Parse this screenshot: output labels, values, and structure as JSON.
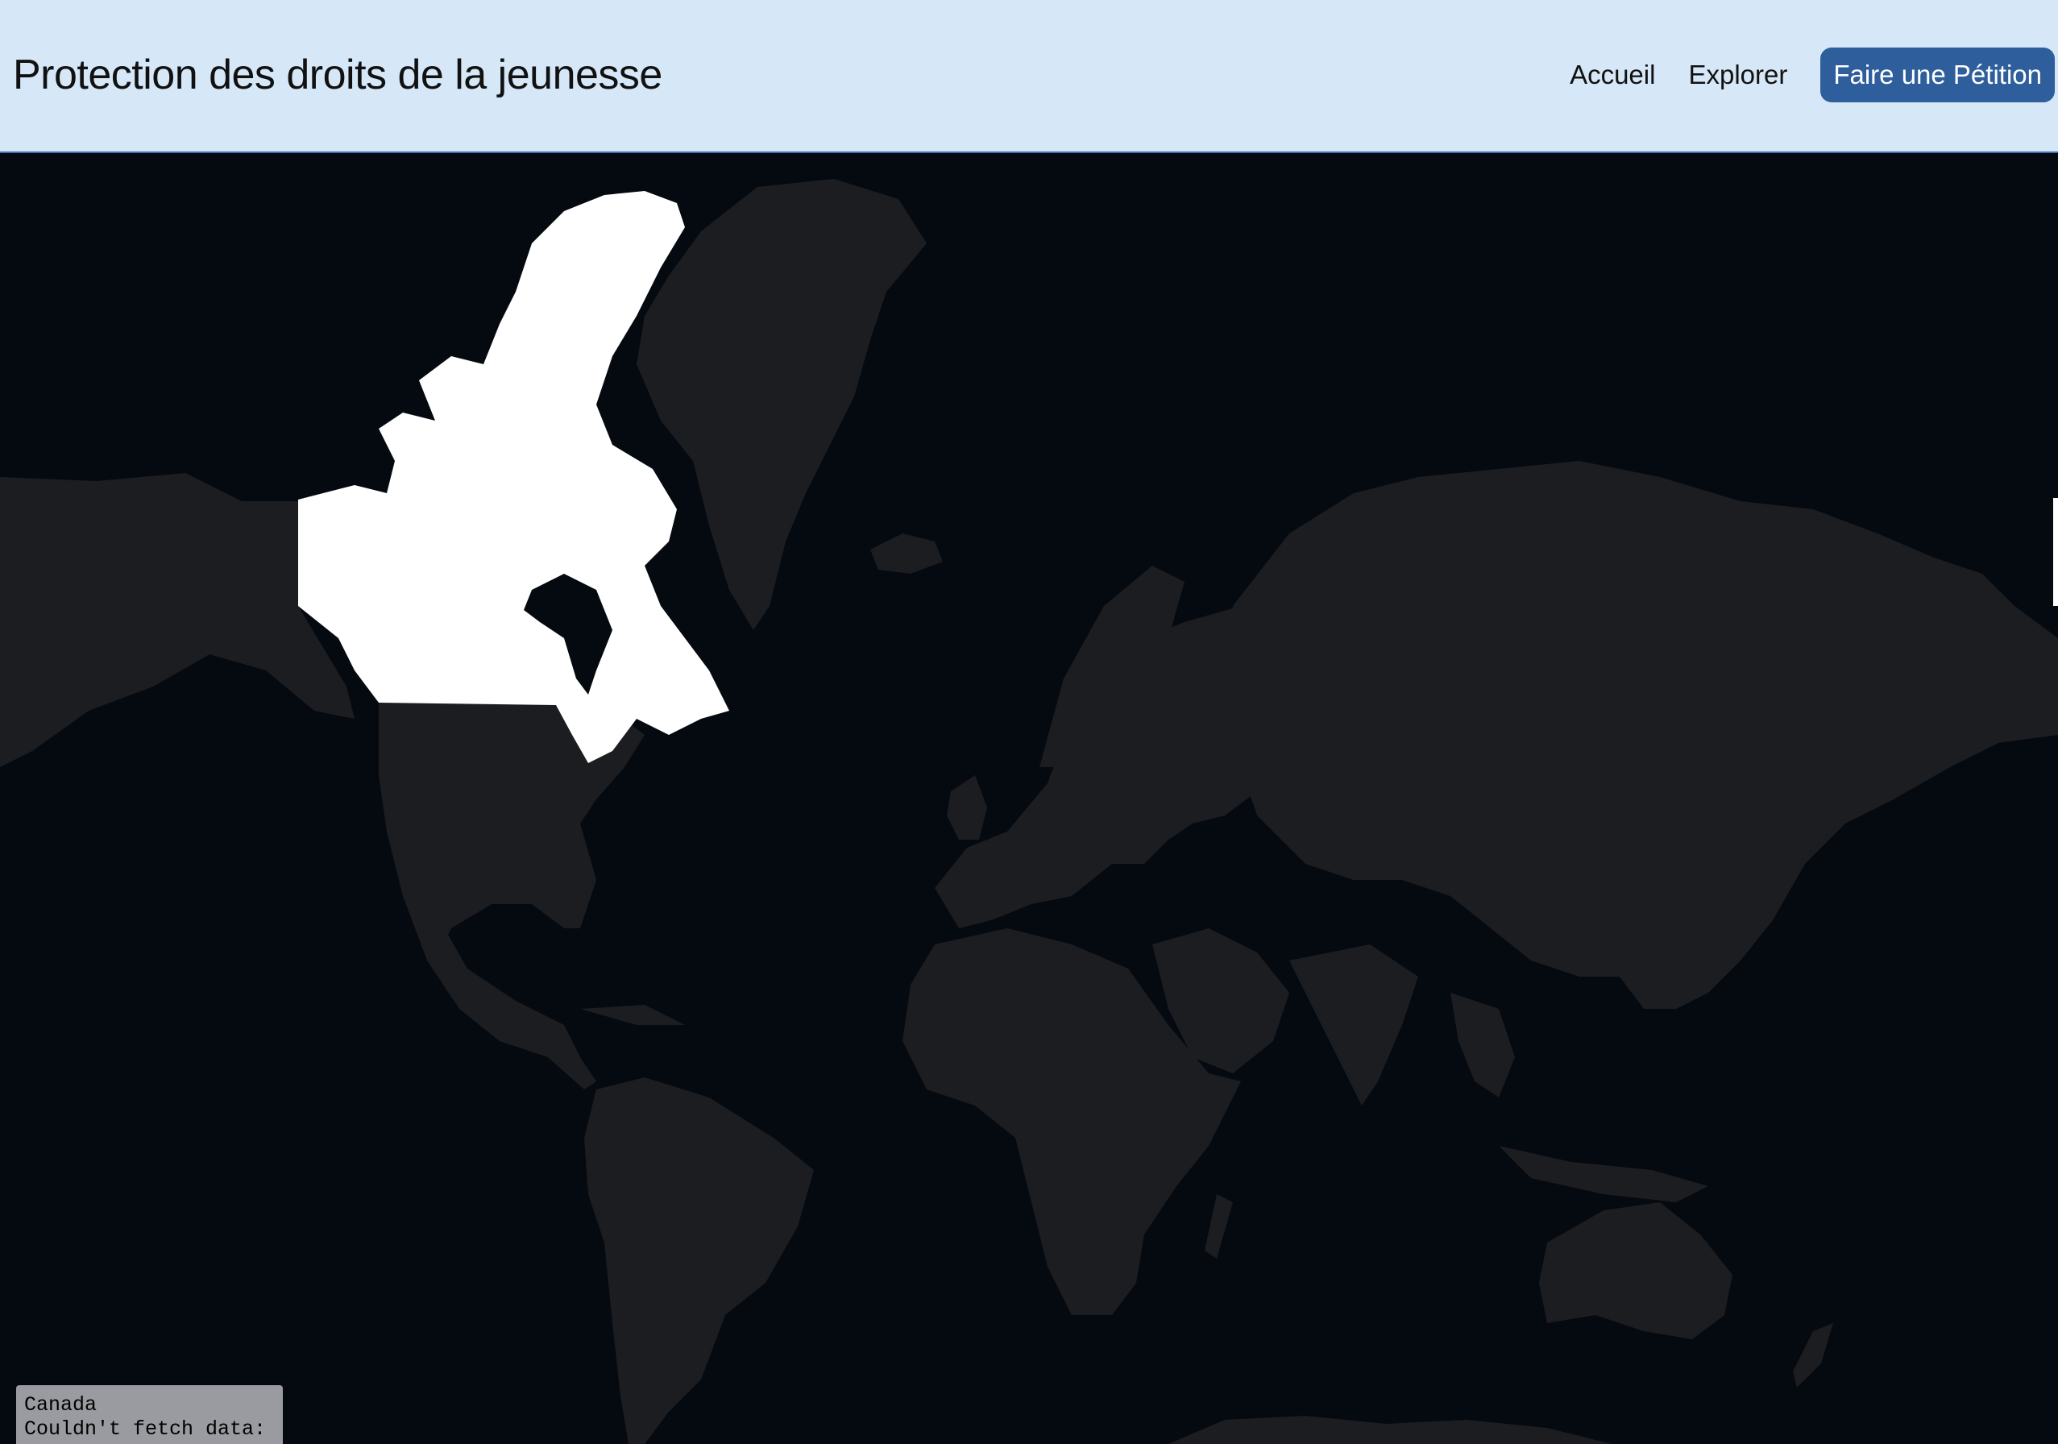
{
  "header": {
    "title": "Protection des droits de la jeunesse",
    "nav": {
      "home_label": "Accueil",
      "explore_label": "Explorer",
      "petition_label": "Faire une Pétition"
    }
  },
  "map": {
    "highlighted_country": "Canada",
    "colors": {
      "ocean": "#050a11",
      "land": "#1c1d21",
      "highlight": "#ffffff",
      "header_bg": "#d6e7f8",
      "cta_bg": "#2e5f9c"
    }
  },
  "info_box": {
    "country": "Canada",
    "message": "Couldn't fetch data:"
  }
}
